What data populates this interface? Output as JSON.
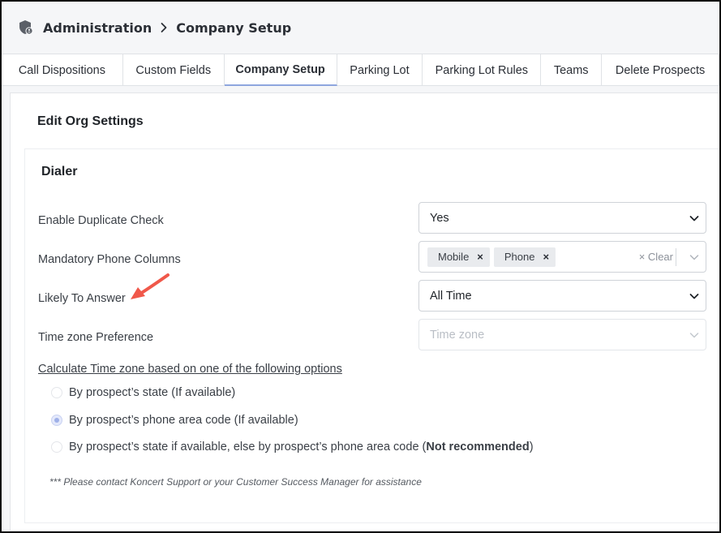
{
  "breadcrumb": {
    "root": "Administration",
    "current": "Company Setup"
  },
  "tabs": [
    {
      "label": "Call Dispositions"
    },
    {
      "label": "Custom Fields"
    },
    {
      "label": "Company Setup",
      "active": true
    },
    {
      "label": "Parking Lot"
    },
    {
      "label": "Parking Lot Rules"
    },
    {
      "label": "Teams"
    },
    {
      "label": "Delete Prospects"
    }
  ],
  "page": {
    "title": "Edit Org Settings"
  },
  "dialer": {
    "title": "Dialer",
    "duplicate_check": {
      "label": "Enable Duplicate Check",
      "value": "Yes"
    },
    "phone_columns": {
      "label": "Mandatory Phone Columns",
      "chips": [
        "Mobile",
        "Phone"
      ],
      "clear_label": "Clear"
    },
    "likely_to_answer": {
      "label": "Likely To Answer",
      "value": "All Time"
    },
    "timezone_pref": {
      "label": "Time zone Preference",
      "placeholder": "Time zone"
    },
    "tz_calc_heading": "Calculate Time zone based on one of the following options",
    "options": [
      {
        "text": "By prospect’s state (If available)",
        "checked": false
      },
      {
        "text": "By prospect’s phone area code (If available)",
        "checked": true
      },
      {
        "text_before": "By prospect’s state if available, else by prospect’s phone area code (",
        "bold": "Not recommended",
        "text_after": ")",
        "checked": false
      }
    ],
    "note": "*** Please contact Koncert Support or your Customer Success Manager for assistance"
  },
  "colors": {
    "accent": "#8ea6de",
    "annotation_arrow": "#f0584a"
  },
  "icons": {
    "breadcrumb_icon": "shield-user-icon",
    "separator": "chevron-right-icon",
    "dropdown": "chevron-down-icon",
    "remove_chip": "close-icon",
    "annotation": "arrow-annotation-icon"
  }
}
